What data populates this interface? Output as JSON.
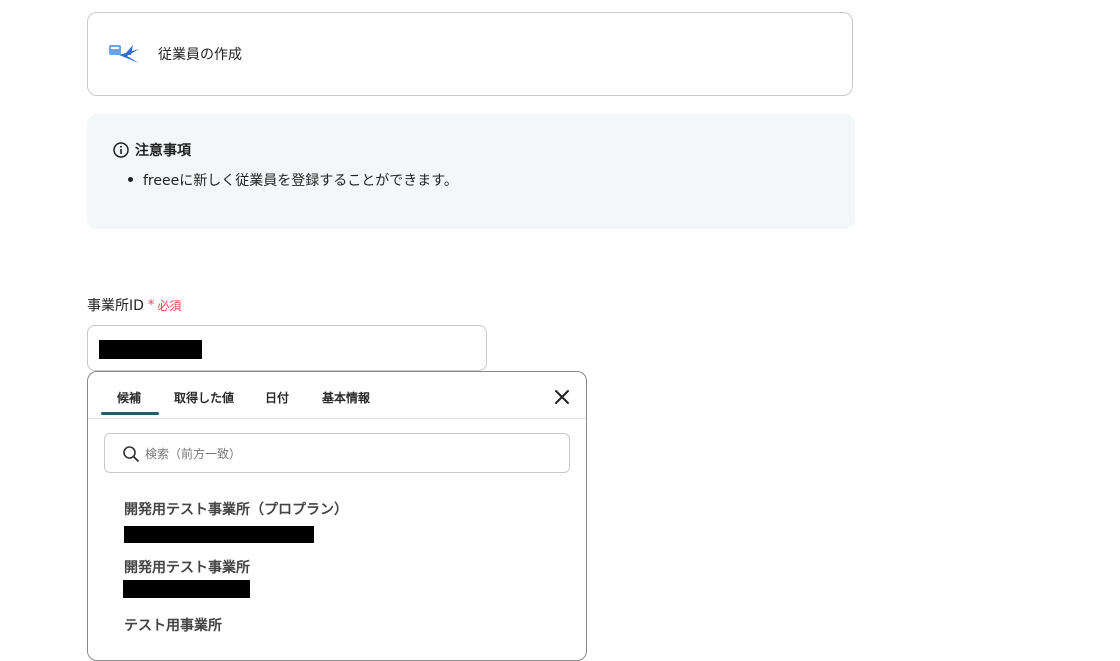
{
  "operation": {
    "title": "従業員の作成",
    "icon": "freee-app-icon"
  },
  "notice": {
    "icon": "info-icon",
    "title": "注意事項",
    "items": [
      "freeeに新しく従業員を登録することができます。"
    ]
  },
  "field": {
    "label": "事業所ID",
    "required_mark": "*",
    "required_text": "必須"
  },
  "popover": {
    "tabs": [
      {
        "label": "候補",
        "active": true
      },
      {
        "label": "取得した値",
        "active": false
      },
      {
        "label": "日付",
        "active": false
      },
      {
        "label": "基本情報",
        "active": false
      }
    ],
    "close_icon": "close-icon",
    "search": {
      "placeholder": "検索（前方一致）",
      "value": ""
    },
    "options": [
      {
        "label": "開発用テスト事業所（プロプラン）"
      },
      {
        "label": "開発用テスト事業所"
      },
      {
        "label": "テスト用事業所"
      }
    ]
  }
}
